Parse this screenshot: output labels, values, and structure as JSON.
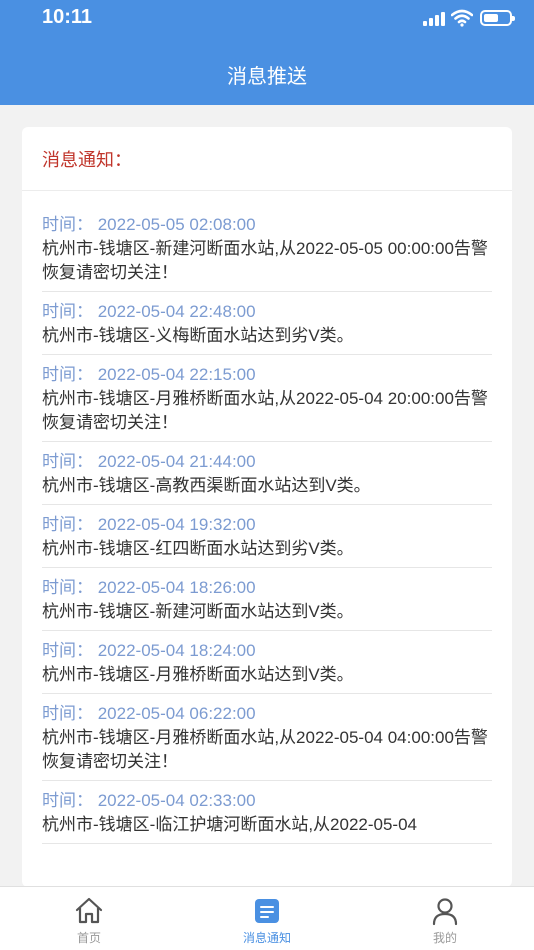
{
  "status_bar": {
    "time": "10:11"
  },
  "header": {
    "title": "消息推送"
  },
  "card": {
    "title": "消息通知："
  },
  "messages": [
    {
      "time": "时间：  2022-05-05 02:08:00",
      "text": "杭州市-钱塘区-新建河断面水站,从2022-05-05 00:00:00告警恢复请密切关注！"
    },
    {
      "time": "时间：  2022-05-04 22:48:00",
      "text": "杭州市-钱塘区-义梅断面水站达到劣V类。"
    },
    {
      "time": "时间：  2022-05-04 22:15:00",
      "text": "杭州市-钱塘区-月雅桥断面水站,从2022-05-04 20:00:00告警恢复请密切关注！"
    },
    {
      "time": "时间：  2022-05-04 21:44:00",
      "text": "杭州市-钱塘区-高教西渠断面水站达到V类。"
    },
    {
      "time": "时间：  2022-05-04 19:32:00",
      "text": "杭州市-钱塘区-红四断面水站达到劣V类。"
    },
    {
      "time": "时间：  2022-05-04 18:26:00",
      "text": "杭州市-钱塘区-新建河断面水站达到V类。"
    },
    {
      "time": "时间：  2022-05-04 18:24:00",
      "text": "杭州市-钱塘区-月雅桥断面水站达到V类。"
    },
    {
      "time": "时间：  2022-05-04 06:22:00",
      "text": "杭州市-钱塘区-月雅桥断面水站,从2022-05-04 04:00:00告警恢复请密切关注！"
    },
    {
      "time": "时间：  2022-05-04 02:33:00",
      "text": "杭州市-钱塘区-临江护塘河断面水站,从2022-05-04"
    }
  ],
  "tabs": [
    {
      "label": "首页",
      "icon": "home-icon"
    },
    {
      "label": "消息通知",
      "icon": "message-icon"
    },
    {
      "label": "我的",
      "icon": "user-icon"
    }
  ],
  "colors": {
    "primary": "#4a90e2",
    "alert_title": "#c0352b",
    "time_text": "#7c9bd1"
  }
}
